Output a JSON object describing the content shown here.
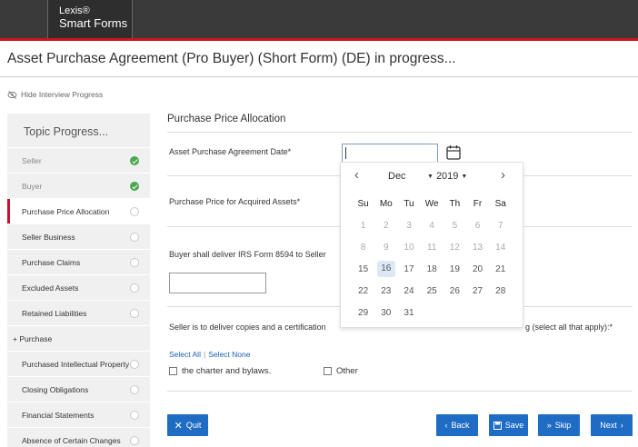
{
  "brand": {
    "line1": "Lexis®",
    "line2": "Smart Forms"
  },
  "document": {
    "title": "Asset Purchase Agreement (Pro Buyer) (Short Form) (DE) in progress..."
  },
  "interview": {
    "hide_progress_label": "Hide Interview Progress",
    "icon": "eye-slash-icon"
  },
  "sidebar": {
    "heading": "Topic Progress...",
    "items": [
      {
        "label": "Seller",
        "status": "complete"
      },
      {
        "label": "Buyer",
        "status": "complete"
      },
      {
        "label": "Purchase Price Allocation",
        "status": "incomplete",
        "active": true
      },
      {
        "label": "Seller Business",
        "status": "incomplete"
      },
      {
        "label": "Purchase Claims",
        "status": "incomplete"
      },
      {
        "label": "Excluded Assets",
        "status": "incomplete"
      },
      {
        "label": "Retained Liabilities",
        "status": "incomplete"
      },
      {
        "label": "+ Purchase",
        "status": "section"
      },
      {
        "label": "Purchased Intellectual Property",
        "status": "incomplete"
      },
      {
        "label": "Closing Obligations",
        "status": "incomplete"
      },
      {
        "label": "Financial Statements",
        "status": "incomplete"
      },
      {
        "label": "Absence of Certain Changes",
        "status": "incomplete"
      }
    ]
  },
  "main": {
    "section_title": "Purchase Price Allocation",
    "q_date": "Asset Purchase Agreement Date*",
    "date_value": "",
    "q_price": "Purchase Price for Acquired Assets*",
    "q_irs": "Buyer shall deliver IRS Form 8594 to Seller",
    "irs_value": "",
    "q_seller_left": "Seller is to deliver copies and a certification",
    "q_seller_right": "g (select all that apply):*",
    "select_all": "Select All",
    "select_none": "Select None",
    "options": [
      "the charter and bylaws.",
      "Other"
    ]
  },
  "calendar": {
    "month": "Dec",
    "year": "2019",
    "weekdays": [
      "Su",
      "Mo",
      "Tu",
      "We",
      "Th",
      "Fr",
      "Sa"
    ],
    "weeks": [
      [
        "1",
        "2",
        "3",
        "4",
        "5",
        "6",
        "7"
      ],
      [
        "8",
        "9",
        "10",
        "11",
        "12",
        "13",
        "14"
      ],
      [
        "15",
        "16",
        "17",
        "18",
        "19",
        "20",
        "21"
      ],
      [
        "22",
        "23",
        "24",
        "25",
        "26",
        "27",
        "28"
      ],
      [
        "29",
        "30",
        "31",
        "",
        "",
        "",
        ""
      ]
    ],
    "today": "16"
  },
  "buttons": {
    "quit": "Quit",
    "back": "Back",
    "save": "Save",
    "skip": "Skip",
    "next": "Next"
  },
  "colors": {
    "brand_red": "#d0131e",
    "button_blue": "#1f6cc4",
    "check_green": "#4aa84e",
    "active_marker": "#c8102e"
  }
}
